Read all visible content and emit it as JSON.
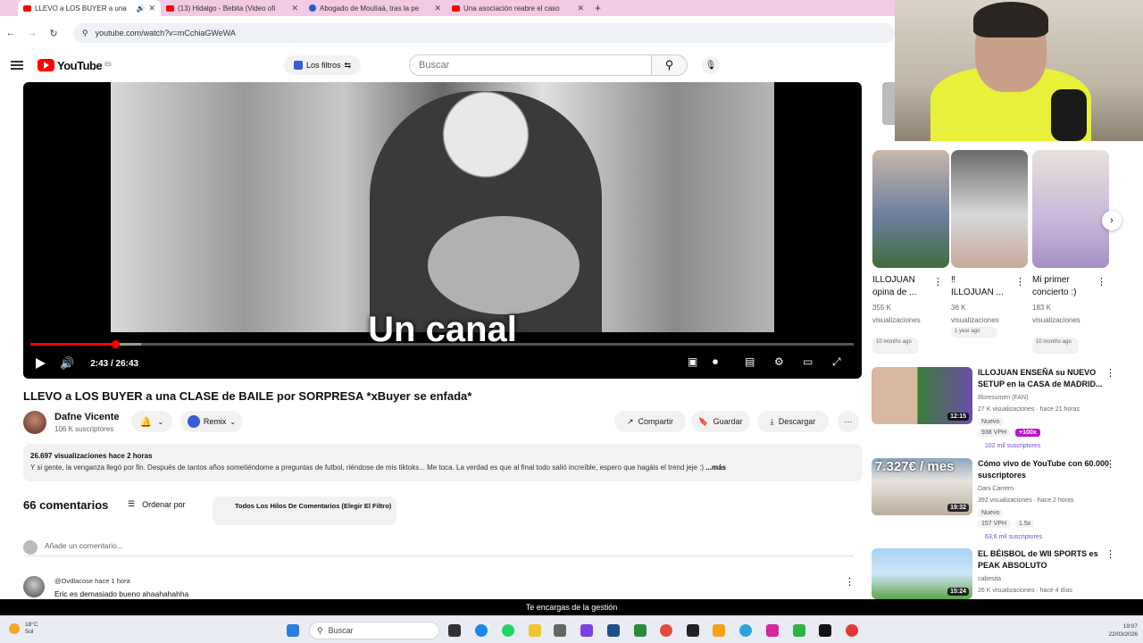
{
  "browser": {
    "tabs": [
      {
        "title": "LLEVO a LOS BUYER a una",
        "active": true,
        "icon": "youtube-icon"
      },
      {
        "title": "(13) Hidalgo - Bebita (Video ofi",
        "active": false,
        "icon": "youtube-icon"
      },
      {
        "title": "Abogado de Moulíaá, tras la pe",
        "active": false,
        "icon": "news-icon"
      },
      {
        "title": "Una asociación reabre el caso",
        "active": false,
        "icon": "youtube-icon"
      }
    ],
    "url": "youtube.com/watch?v=mCchiaGWeWA",
    "tab_close": "✕",
    "new_tab": "+"
  },
  "header": {
    "logo_text": "YouTube",
    "logo_country": "ES",
    "filters_label": "Los filtros",
    "search_placeholder": "Buscar"
  },
  "player": {
    "caption": "Un canal",
    "time": "2:43 / 26:43",
    "progress_fraction": 0.103,
    "buffered_fraction": 0.135
  },
  "video": {
    "title": "LLEVO a LOS BUYER a una CLASE de BAILE por SORPRESA *xBuyer se enfada*",
    "channel": "Dafne Vicente",
    "subscribers": "106 K suscriptores",
    "remix_label": "Remix",
    "share_label": "Compartir",
    "save_label": "Guardar",
    "download_label": "Descargar",
    "views_date": "26.697 visualizaciones  hace 2 horas",
    "description": "Y si gente, la venganza llegó por fin. Después de tantos años sometiéndome a preguntas de futbol, riéndose de mis tiktoks... Me toca. La verdad es que al final todo salió increíble, espero que hagáis el trend jeje :)",
    "more_label": "...más"
  },
  "comments": {
    "count": "66 comentarios",
    "sort_label": "Ordenar por",
    "filter_label": "Todos Los Hilos De Comentarios (Elegir El Filtro)",
    "add_placeholder": "Añade un comentario...",
    "items": [
      {
        "user": "@Ovdlacose",
        "time": "hace 1 hora",
        "text": "Eric es demasiado bueno ahaahahahha"
      }
    ]
  },
  "shorts": [
    {
      "title": "ILLOJUAN",
      "title2": "opina de ...",
      "views": "355 K",
      "views2": "visualizaciones",
      "badge": "10 months ago"
    },
    {
      "title": "‼",
      "title2": "ILLOJUAN ...",
      "views": "36 K",
      "views2": "visualizaciones",
      "badge": "1 year ago"
    },
    {
      "title": "Mi primer",
      "title2": "concierto :)",
      "views": "183 K",
      "views2": "visualizaciones",
      "badge": "10 months ago"
    }
  ],
  "related": [
    {
      "title": "ILLOJUAN ENSEÑA su NUEVO SETUP en la CASA de MADRID...",
      "channel": "Illoresumen (FAN)",
      "meta": "27 K visualizaciones · hace 21 horas",
      "tag": "Nuevo",
      "vph": "938 VPH",
      "ratio": "+100x",
      "subs": "102 mil suscriptores",
      "duration": "12:15"
    },
    {
      "title": "Cómo vivo de YouTube con 60.000 suscriptores",
      "channel": "Dani Carrero",
      "meta": "392 visualizaciones · hace 2 horas",
      "tag": "Nuevo",
      "vph": "157 VPH",
      "ratio": "1.5x",
      "subs": "63,6 mil suscriptores",
      "duration": "19:32",
      "overlay": "7.327€ / mes"
    },
    {
      "title": "EL BÉISBOL de WII SPORTS es PEAK ABSOLUTO",
      "channel": "cabesita",
      "meta": "26 K visualizaciones · hace 4 días",
      "duration": "15:24"
    }
  ],
  "banner": "Te encargas de la gestión",
  "taskbar": {
    "temp": "18°C",
    "weather": "Sol",
    "search": "Buscar",
    "time": "19:07",
    "date": "22/03/2026"
  },
  "colors": {
    "accent": "#ff0000",
    "tabbar": "#f3c9e3",
    "vph_badge": "#c00fd0",
    "subs_text": "#6a4fd8"
  }
}
